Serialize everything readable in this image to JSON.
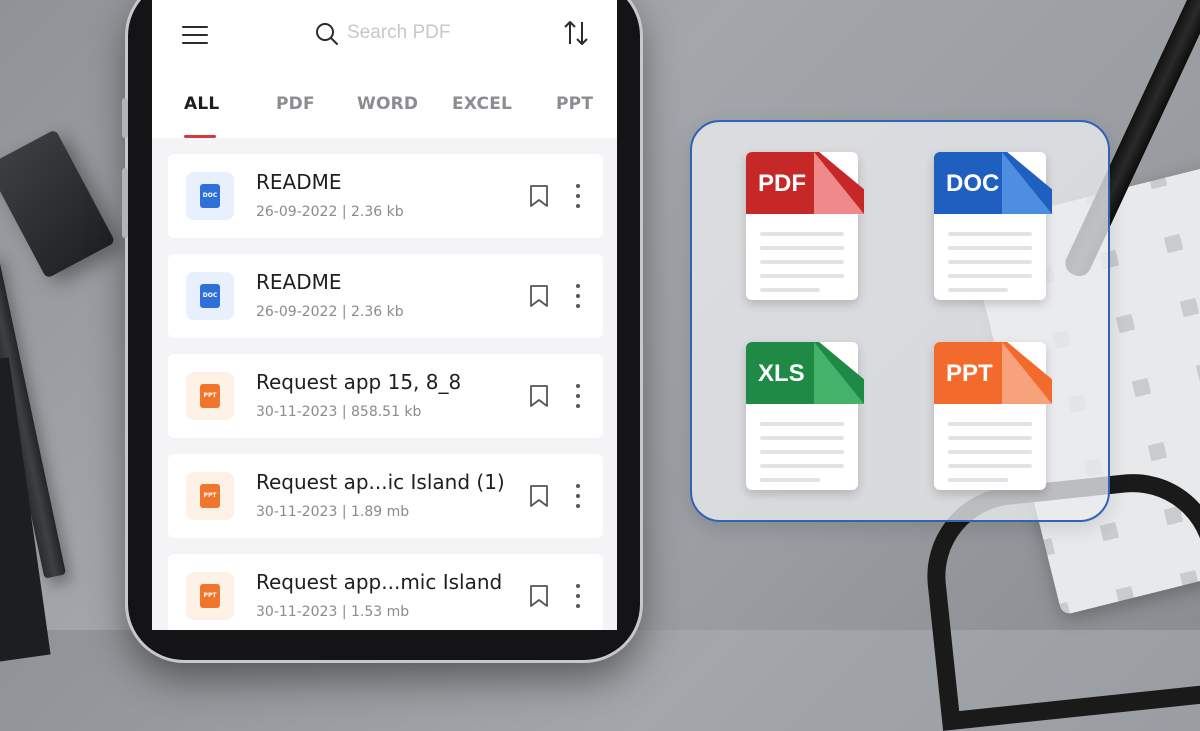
{
  "header": {
    "search_placeholder": "Search PDF"
  },
  "tabs": [
    {
      "label": "ALL",
      "active": true
    },
    {
      "label": "PDF",
      "active": false
    },
    {
      "label": "WORD",
      "active": false
    },
    {
      "label": "EXCEL",
      "active": false
    },
    {
      "label": "PPT",
      "active": false
    }
  ],
  "files": [
    {
      "name": "README",
      "date": "26-09-2022",
      "size": "2.36 kb",
      "type": "doc",
      "icon": "doc-file-icon",
      "badge": "DOC"
    },
    {
      "name": "README",
      "date": "26-09-2022",
      "size": "2.36 kb",
      "type": "doc",
      "icon": "doc-file-icon",
      "badge": "DOC"
    },
    {
      "name": "Request app 15, 8_8",
      "date": "30-11-2023",
      "size": "858.51 kb",
      "type": "ppt",
      "icon": "ppt-file-icon",
      "badge": "PPT"
    },
    {
      "name": "Request ap...ic Island (1)",
      "date": "30-11-2023",
      "size": "1.89 mb",
      "type": "ppt",
      "icon": "ppt-file-icon",
      "badge": "PPT"
    },
    {
      "name": "Request app...mic Island",
      "date": "30-11-2023",
      "size": "1.53 mb",
      "type": "ppt",
      "icon": "ppt-file-icon",
      "badge": "PPT"
    }
  ],
  "meta_separator": "|",
  "file_types": [
    {
      "label": "PDF",
      "color": "#c62828",
      "fold_color": "#f08a8a"
    },
    {
      "label": "DOC",
      "color": "#1f5fbf",
      "fold_color": "#4d8ee0"
    },
    {
      "label": "XLS",
      "color": "#1e8a45",
      "fold_color": "#44b36a"
    },
    {
      "label": "PPT",
      "color": "#f26b2c",
      "fold_color": "#f7a27c"
    }
  ],
  "colors": {
    "accent": "#d9363e",
    "panel_border": "#2f63b4"
  }
}
